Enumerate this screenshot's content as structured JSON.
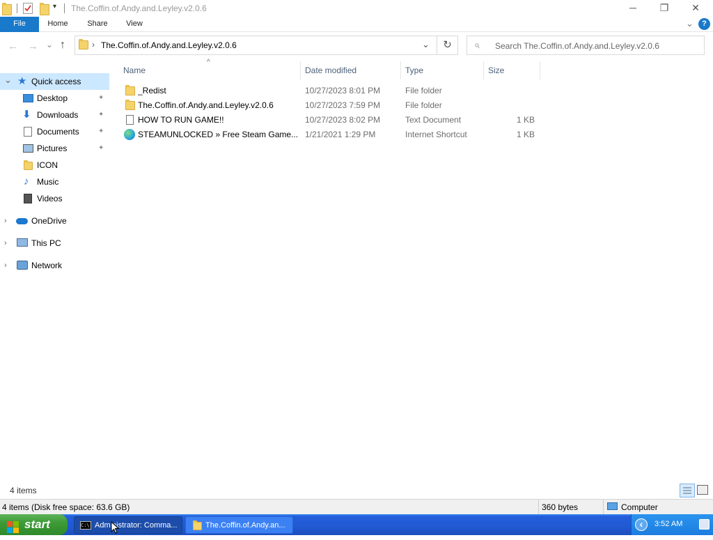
{
  "window": {
    "title": "The.Coffin.of.Andy.and.Leyley.v2.0.6",
    "minimize_glyph": "─",
    "restore_glyph": "❐",
    "close_glyph": "✕"
  },
  "ribbon": {
    "tabs": [
      "File",
      "Home",
      "Share",
      "View"
    ],
    "expand_glyph": "⌄",
    "help_glyph": "?"
  },
  "nav": {
    "back_glyph": "←",
    "forward_glyph": "→",
    "recent_glyph": "⌄",
    "up_glyph": "↑",
    "breadcrumb_sep": "›",
    "path": "The.Coffin.of.Andy.and.Leyley.v2.0.6",
    "dropdown_glyph": "⌄",
    "refresh_glyph": "↻",
    "search_placeholder": "Search The.Coffin.of.Andy.and.Leyley.v2.0.6",
    "search_glyph": "⌕"
  },
  "sidebar": {
    "quick_access": "Quick access",
    "quick_items": [
      {
        "label": "Desktop",
        "pinned": true,
        "icon": "desktop-icon"
      },
      {
        "label": "Downloads",
        "pinned": true,
        "icon": "downloads-icon"
      },
      {
        "label": "Documents",
        "pinned": true,
        "icon": "documents-icon"
      },
      {
        "label": "Pictures",
        "pinned": true,
        "icon": "pictures-icon"
      },
      {
        "label": "ICON",
        "pinned": false,
        "icon": "folder-icon"
      },
      {
        "label": "Music",
        "pinned": false,
        "icon": "music-icon"
      },
      {
        "label": "Videos",
        "pinned": false,
        "icon": "videos-icon"
      }
    ],
    "roots": [
      "OneDrive",
      "This PC",
      "Network"
    ],
    "expanded_glyph": "⌄",
    "collapsed_glyph": "›",
    "pin_glyph": "📌"
  },
  "columns": {
    "name": "Name",
    "date": "Date modified",
    "type": "Type",
    "size": "Size",
    "sort_glyph": "^"
  },
  "files": [
    {
      "name": "_Redist",
      "date": "10/27/2023 8:01 PM",
      "type": "File folder",
      "size": "",
      "icon": "folder-icon"
    },
    {
      "name": "The.Coffin.of.Andy.and.Leyley.v2.0.6",
      "date": "10/27/2023 7:59 PM",
      "type": "File folder",
      "size": "",
      "icon": "folder-icon"
    },
    {
      "name": "HOW TO RUN GAME!!",
      "date": "10/27/2023 8:02 PM",
      "type": "Text Document",
      "size": "1 KB",
      "icon": "text-file-icon"
    },
    {
      "name": "STEAMUNLOCKED » Free Steam Game...",
      "date": "1/21/2021 1:29 PM",
      "type": "Internet Shortcut",
      "size": "1 KB",
      "icon": "edge-icon"
    }
  ],
  "status": {
    "item_count": "4 items",
    "disk_info": "4 items (Disk free space: 63.6 GB)",
    "selection_size": "360 bytes",
    "location": "Computer"
  },
  "taskbar": {
    "start_label": "start",
    "tasks": [
      {
        "label": "Administrator: Comma...",
        "icon": "cmd-icon"
      },
      {
        "label": "The.Coffin.of.Andy.an...",
        "icon": "folder-icon"
      }
    ],
    "clock": "3:52 AM",
    "tray_collapse_glyph": "‹"
  },
  "colors": {
    "accent": "#1979ca",
    "selection": "#cce8ff",
    "taskbar": "#245edb",
    "start": "#3d9b37"
  }
}
